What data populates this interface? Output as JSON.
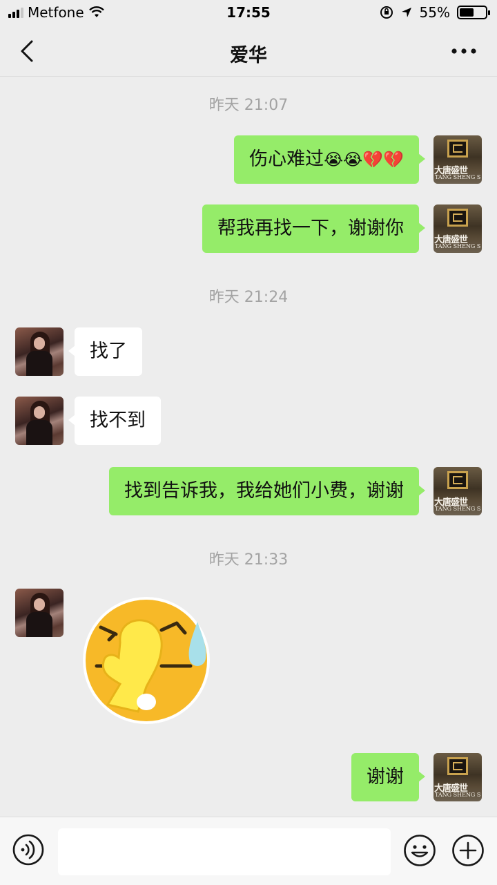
{
  "status_bar": {
    "carrier": "Metfone",
    "time": "17:55",
    "battery_percent": "55%",
    "battery_level": 0.55
  },
  "header": {
    "title": "爱华",
    "back_icon": "chevron-left-icon",
    "more_icon": "more-dots-icon"
  },
  "chat": {
    "timestamps": [
      "昨天 21:07",
      "昨天 21:24",
      "昨天 21:33"
    ],
    "messages": [
      {
        "sender": "me",
        "text": "伤心难过",
        "emojis": "😭😭💔💔"
      },
      {
        "sender": "me",
        "text": "帮我再找一下，谢谢你"
      },
      {
        "sender": "contact",
        "text": "找了"
      },
      {
        "sender": "contact",
        "text": "找不到"
      },
      {
        "sender": "me",
        "text": "找到告诉我，我给她们小费，谢谢"
      },
      {
        "sender": "contact",
        "sticker": "facepalm-sweat-emoji"
      },
      {
        "sender": "me",
        "text": "谢谢"
      }
    ],
    "my_avatar": {
      "brand_cn": "大唐盛世",
      "brand_en": "TANG SHENG SHI"
    }
  },
  "input_bar": {
    "value": "",
    "placeholder": "",
    "voice_icon": "voice-icon",
    "emoji_icon": "emoji-icon",
    "plus_icon": "plus-icon"
  },
  "colors": {
    "outgoing_bubble": "#95ec69",
    "incoming_bubble": "#ffffff",
    "background": "#ededed",
    "timestamp": "#a3a3a3"
  }
}
